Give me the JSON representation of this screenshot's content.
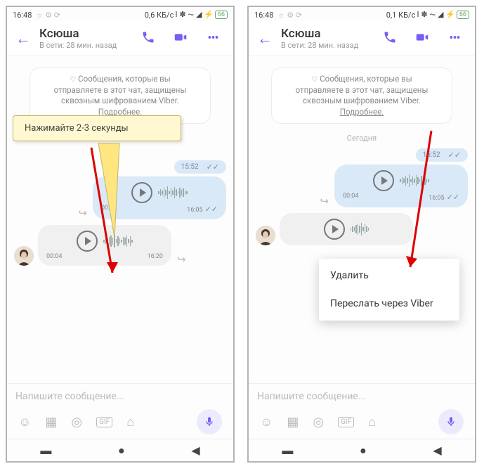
{
  "status": {
    "time": "16:48",
    "net": "0,6 КБ/с"
  },
  "header": {
    "name": "Ксюша",
    "lastseen": "В сети: 28 мин. назад"
  },
  "encryption": {
    "line1": "Сообщения, которые вы",
    "line2": "отправляете в этот чат, защищены",
    "line3": "сквозным шифрованием Viber.",
    "more": "Подробнее."
  },
  "today": "Сегодня",
  "msg1": {
    "time": "15:52"
  },
  "msg2": {
    "dur": "00:04",
    "time": "16:05"
  },
  "msg3": {
    "dur": "00:04",
    "time": "16:20"
  },
  "input": {
    "placeholder": "Напишите сообщение..."
  },
  "callout": {
    "text": "Нажимайте 2-3 секунды"
  },
  "menu": {
    "delete": "Удалить",
    "forward": "Переслать через Viber"
  },
  "icons": {
    "gif": "GIF"
  }
}
